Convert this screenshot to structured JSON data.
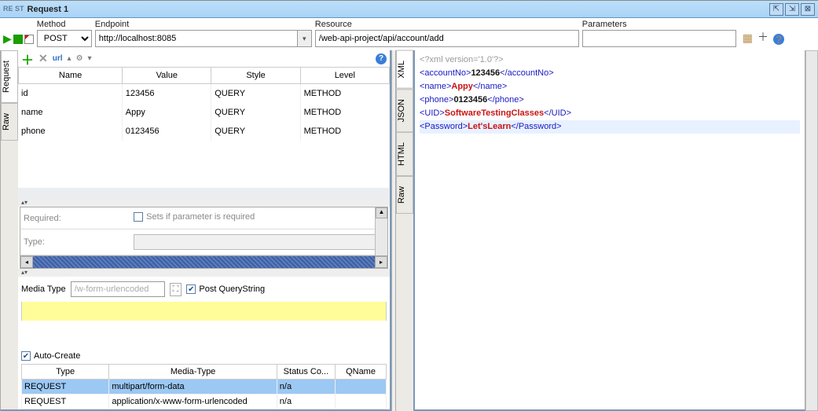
{
  "window": {
    "title": "Request 1",
    "rest_badge": "RE\nST"
  },
  "toolbar": {
    "method_label": "Method",
    "method_value": "POST",
    "endpoint_label": "Endpoint",
    "endpoint_value": "http://localhost:8085",
    "resource_label": "Resource",
    "resource_value": "/web-api-project/api/account/add",
    "params_label": "Parameters",
    "params_value": ""
  },
  "left_tabs": {
    "request": "Request",
    "raw": "Raw"
  },
  "params_table": {
    "headers": {
      "name": "Name",
      "value": "Value",
      "style": "Style",
      "level": "Level"
    },
    "rows": [
      {
        "name": "id",
        "value": "123456",
        "style": "QUERY",
        "level": "METHOD"
      },
      {
        "name": "name",
        "value": "Appy",
        "style": "QUERY",
        "level": "METHOD"
      },
      {
        "name": "phone",
        "value": "0123456",
        "style": "QUERY",
        "level": "METHOD"
      }
    ]
  },
  "props": {
    "required_label": "Required:",
    "required_cb": "Sets if parameter is required",
    "type_label": "Type:"
  },
  "media": {
    "label": "Media Type",
    "value": "/w-form-urlencoded",
    "post_qs": "Post QueryString"
  },
  "auto_create": "Auto-Create",
  "attach_table": {
    "headers": {
      "type": "Type",
      "media": "Media-Type",
      "status": "Status Co...",
      "qname": "QName"
    },
    "rows": [
      {
        "type": "REQUEST",
        "media": "multipart/form-data",
        "status": "n/a",
        "qname": ""
      },
      {
        "type": "REQUEST",
        "media": "application/x-www-form-urlencoded",
        "status": "n/a",
        "qname": ""
      }
    ]
  },
  "right_tabs": {
    "xml": "XML",
    "json": "JSON",
    "html": "HTML",
    "raw": "Raw"
  },
  "response": {
    "decl": "<?xml version='1.0'?>",
    "accountNo": "123456",
    "name": "Appy",
    "phone": "0123456",
    "uid": "SoftwareTestingClasses",
    "password": "Let'sLearn"
  }
}
